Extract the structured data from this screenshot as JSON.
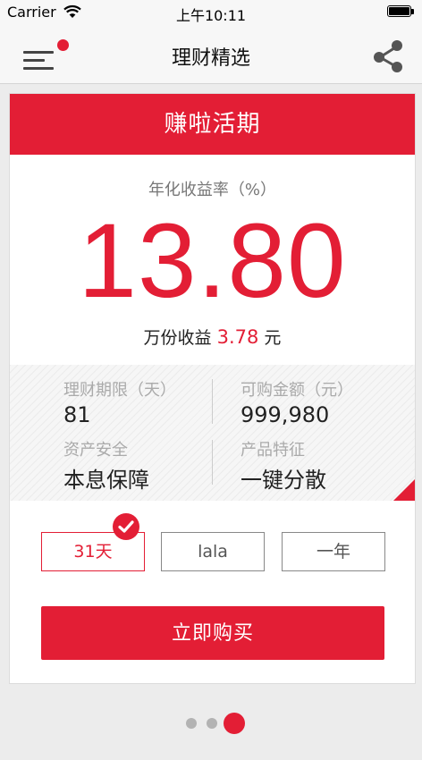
{
  "status_bar": {
    "carrier": "Carrier",
    "time": "上午10:11",
    "wifi_icon": "wifi-icon",
    "battery_icon": "battery-icon"
  },
  "nav": {
    "title": "理财精选",
    "menu_icon": "hamburger-menu-icon",
    "notification_dot_color": "#e31e35",
    "share_icon": "share-icon"
  },
  "product": {
    "name": "赚啦活期",
    "rate_label": "年化收益率（%）",
    "rate_value": "13.80",
    "income_label": "万份收益",
    "income_value": "3.78",
    "income_unit": "元",
    "details": [
      {
        "label": "理财期限（天）",
        "value": "81"
      },
      {
        "label": "可购金额（元）",
        "value": "999,980"
      },
      {
        "label": "资产安全",
        "value": "本息保障"
      },
      {
        "label": "产品特征",
        "value": "一键分散"
      }
    ]
  },
  "options": [
    {
      "label": "31天",
      "selected": true
    },
    {
      "label": "lala",
      "selected": false
    },
    {
      "label": "一年",
      "selected": false
    }
  ],
  "buy_button": {
    "label": "立即购买"
  },
  "pager": {
    "count": 3,
    "current": 3
  },
  "colors": {
    "accent": "#e31e35",
    "background": "#ececec",
    "card": "#ffffff"
  }
}
